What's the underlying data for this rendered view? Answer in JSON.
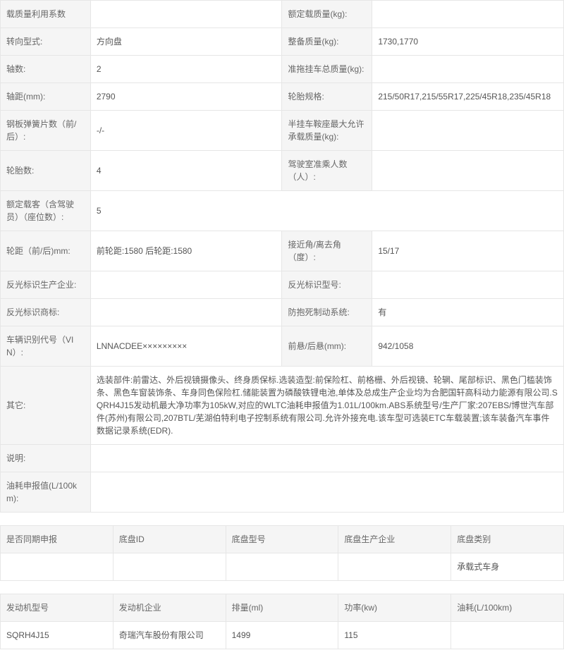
{
  "t1": {
    "rows": [
      [
        {
          "l": "载质量利用系数",
          "v": ""
        },
        {
          "l": "额定载质量(kg):",
          "v": ""
        }
      ],
      [
        {
          "l": "转向型式:",
          "v": "方向盘"
        },
        {
          "l": "整备质量(kg):",
          "v": "1730,1770"
        }
      ],
      [
        {
          "l": "轴数:",
          "v": "2"
        },
        {
          "l": "准拖挂车总质量(kg):",
          "v": ""
        }
      ],
      [
        {
          "l": "轴距(mm):",
          "v": "2790"
        },
        {
          "l": "轮胎规格:",
          "v": "215/50R17,215/55R17,225/45R18,235/45R18"
        }
      ],
      [
        {
          "l": "钢板弹簧片数（前/后）:",
          "v": "-/-"
        },
        {
          "l": "半挂车鞍座最大允许承载质量(kg):",
          "v": ""
        }
      ],
      [
        {
          "l": "轮胎数:",
          "v": "4"
        },
        {
          "l": "驾驶室准乘人数（人）:",
          "v": ""
        }
      ],
      [
        {
          "l": "额定载客（含驾驶员）（座位数）:",
          "v": "5"
        },
        null
      ],
      [
        {
          "l": "轮距（前/后)mm:",
          "v": "前轮距:1580 后轮距:1580"
        },
        {
          "l": "接近角/离去角（度）:",
          "v": "15/17"
        }
      ],
      [
        {
          "l": "反光标识生产企业:",
          "v": ""
        },
        {
          "l": "反光标识型号:",
          "v": ""
        }
      ],
      [
        {
          "l": "反光标识商标:",
          "v": ""
        },
        {
          "l": "防抱死制动系统:",
          "v": "有"
        }
      ],
      [
        {
          "l": "车辆识别代号（VIN）:",
          "v": "LNNACDEE×××××××××"
        },
        {
          "l": "前悬/后悬(mm):",
          "v": "942/1058"
        }
      ]
    ],
    "full": [
      {
        "l": "其它:",
        "v": "选装部件:前雷达、外后视镜摄像头、终身质保标.选装造型:前保险杠、前格栅、外后视镜、轮辋、尾部标识、黑色门槛装饰条、黑色车窗装饰条、车身同色保险杠.储能装置为磷酸铁锂电池,单体及总成生产企业均为合肥国轩高科动力能源有限公司.SQRH4J15发动机最大净功率为105kW,对应的WLTC油耗申报值为1.01L/100km.ABS系统型号/生产厂家:207EBS/博世汽车部件(苏州)有限公司,207BTL/芜湖伯特利电子控制系统有限公司.允许外接充电.该车型可选装ETC车载装置;该车装备汽车事件数据记录系统(EDR)."
      },
      {
        "l": "说明:",
        "v": ""
      },
      {
        "l": "油耗申报值(L/100km):",
        "v": ""
      }
    ]
  },
  "t2": {
    "headers": [
      "是否同期申报",
      "底盘ID",
      "底盘型号",
      "底盘生产企业",
      "底盘类别"
    ],
    "row": [
      "",
      "",
      "",
      "",
      "承载式车身"
    ]
  },
  "t3": {
    "headers": [
      "发动机型号",
      "发动机企业",
      "排量(ml)",
      "功率(kw)",
      "油耗(L/100km)"
    ],
    "row": [
      "SQRH4J15",
      "奇瑞汽车股份有限公司",
      "1499",
      "115",
      ""
    ]
  }
}
